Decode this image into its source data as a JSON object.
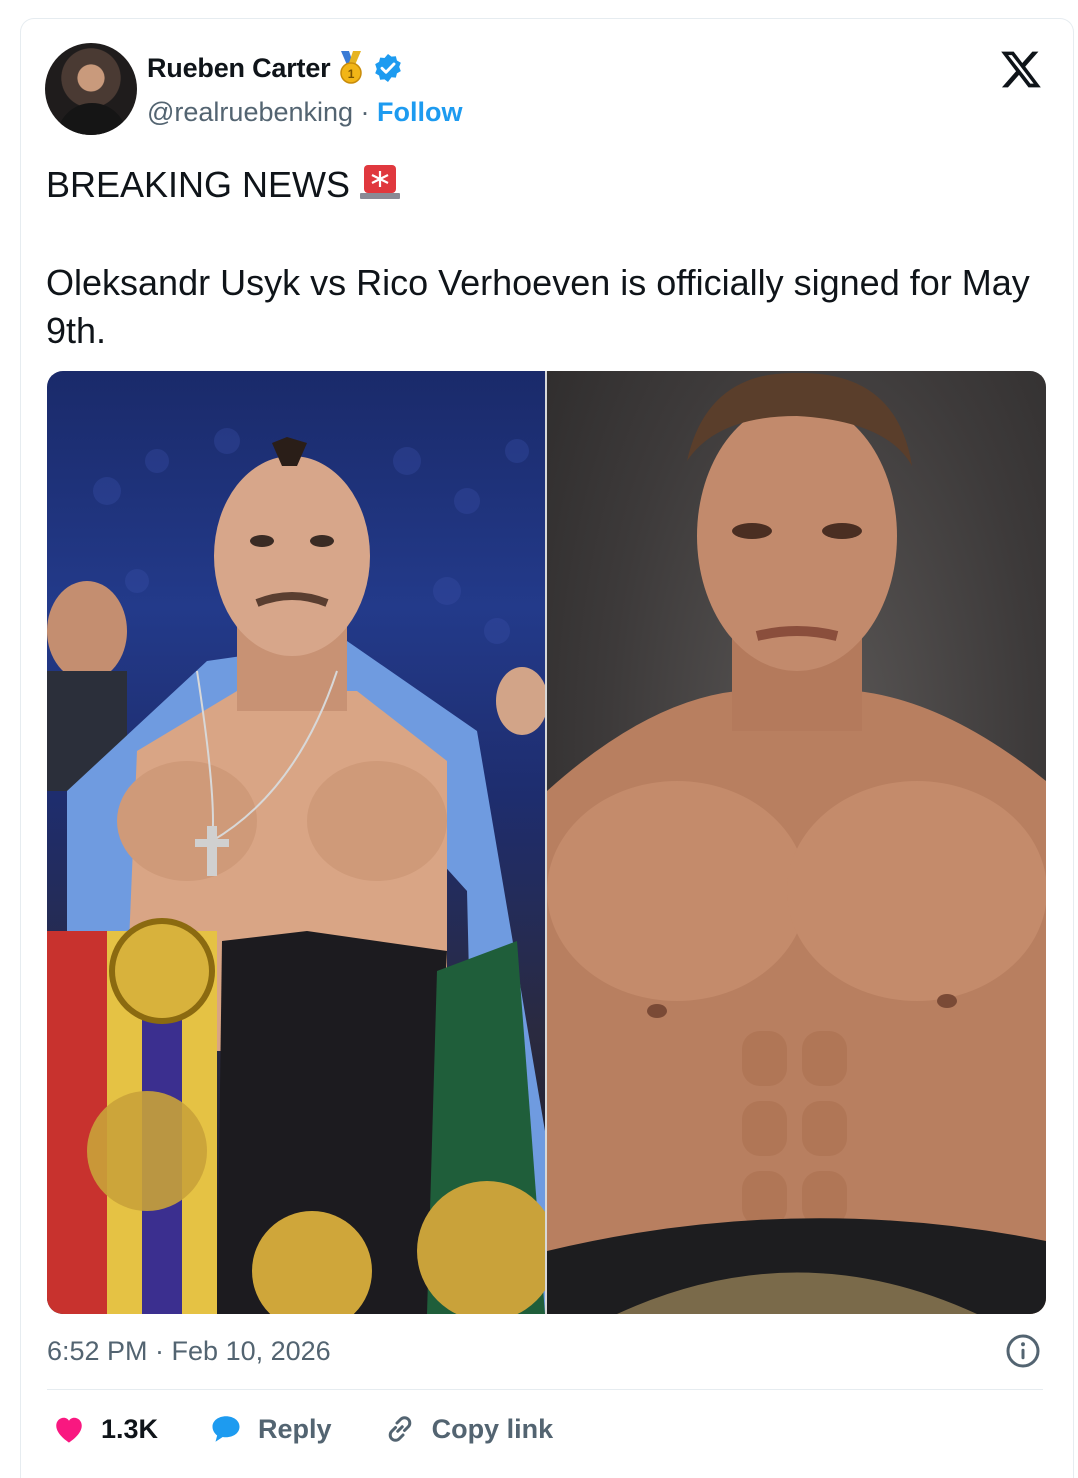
{
  "author": {
    "name": "Rueben Carter",
    "handle": "@realruebenking",
    "separator": " · ",
    "follow_label": "Follow"
  },
  "icons": {
    "badge": "medal-icon",
    "verified": "verified-badge-icon",
    "platform": "x-logo-icon",
    "siren": "siren-icon",
    "info": "info-icon",
    "like": "heart-icon",
    "reply": "reply-bubble-icon",
    "copy": "link-icon"
  },
  "tweet": {
    "line1": "BREAKING NEWS",
    "line2": "Oleksandr Usyk vs Rico Verhoeven is officially signed for May 9th."
  },
  "timestamp": "6:52 PM · Feb 10, 2026",
  "actions": {
    "likes": "1.3K",
    "reply_label": "Reply",
    "copy_label": "Copy link"
  },
  "colors": {
    "accent": "#1d9bf0",
    "like": "#f91880",
    "muted": "#536471",
    "text": "#0f1419"
  }
}
